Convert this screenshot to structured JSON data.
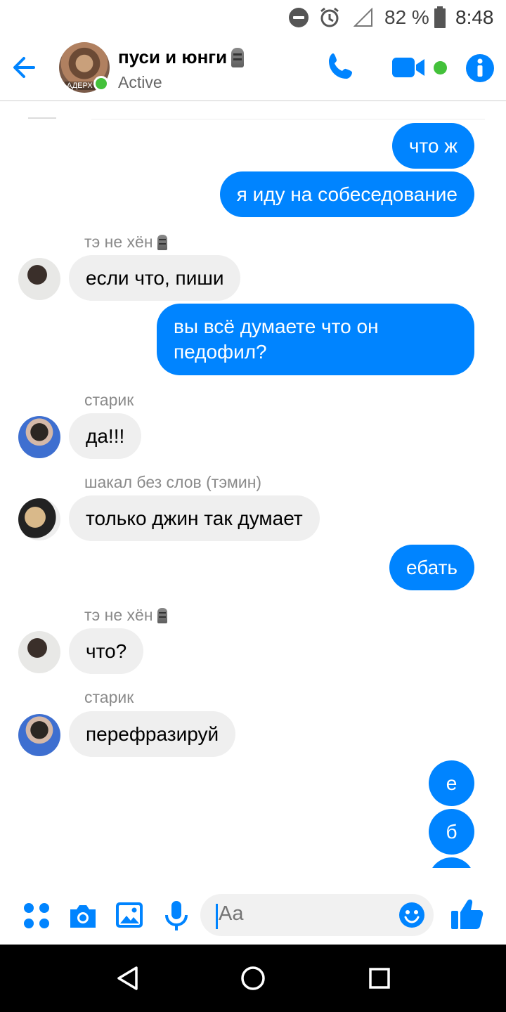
{
  "status_bar": {
    "battery_percent": "82 %",
    "time": "8:48"
  },
  "header": {
    "title": "пуси и юнги",
    "status": "Active",
    "avatar_tag": "АДЕРХ",
    "icons": [
      "back-arrow-icon",
      "phone-icon",
      "video-camera-icon",
      "info-icon"
    ],
    "accent_color": "#0084ff",
    "online_color": "#43c13a"
  },
  "messages": [
    {
      "type": "out",
      "text": "что ж"
    },
    {
      "type": "out",
      "text": "я иду на собеседование"
    },
    {
      "type": "sender",
      "name": "тэ не хён"
    },
    {
      "type": "in",
      "text": "если что, пиши"
    },
    {
      "type": "out",
      "text": "вы всё думаете что он педофил?"
    },
    {
      "type": "sender",
      "name": "старик"
    },
    {
      "type": "in",
      "text": "да!!!"
    },
    {
      "type": "sender",
      "name": "шакал без слов (тэмин)"
    },
    {
      "type": "in",
      "text": "только джин так думает"
    },
    {
      "type": "out",
      "text": "ебать"
    },
    {
      "type": "sender",
      "name": "тэ не хён"
    },
    {
      "type": "in",
      "text": "что?"
    },
    {
      "type": "sender",
      "name": "старик"
    },
    {
      "type": "in",
      "text": "перефразируй"
    },
    {
      "type": "out",
      "text": "е"
    },
    {
      "type": "out",
      "text": "б"
    }
  ],
  "input_bar": {
    "placeholder": "Aa",
    "icons": [
      "apps-grid-icon",
      "camera-icon",
      "gallery-icon",
      "microphone-icon",
      "emoji-icon",
      "thumbs-up-icon"
    ]
  },
  "nav_bar": {
    "icons": [
      "nav-back-icon",
      "nav-home-icon",
      "nav-recents-icon"
    ]
  }
}
